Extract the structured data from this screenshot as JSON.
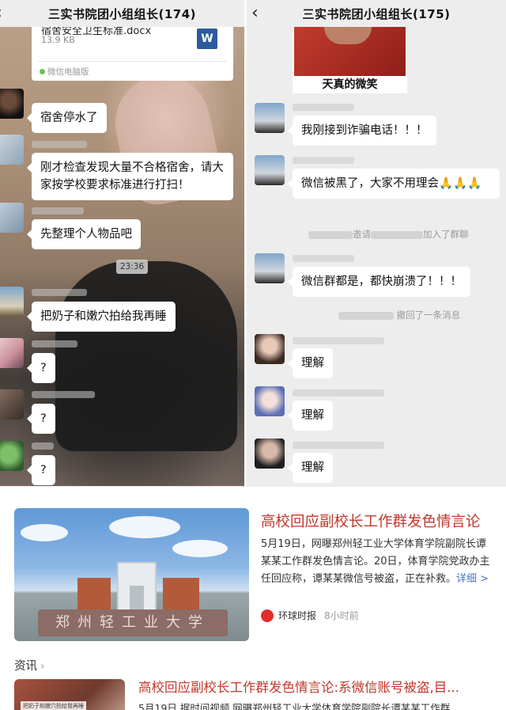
{
  "left_chat": {
    "title": "三实书院团小组组长(174)",
    "file": {
      "name": "宿舍安全卫生标准.docx",
      "size": "13.9 KB",
      "source": "微信电脑版",
      "icon": "W"
    },
    "messages": [
      {
        "text": "宿舍停水了"
      },
      {
        "text": "刚才检查发现大量不合格宿舍，请大家按学校要求标准进行打扫！"
      },
      {
        "text": "先整理个人物品吧"
      },
      {
        "text": "把奶子和嫩穴拍给我再睡"
      },
      {
        "text": "?"
      },
      {
        "text": "?"
      },
      {
        "text": "?"
      }
    ],
    "timestamp": "23:36"
  },
  "right_chat": {
    "title": "三实书院团小组组长(175)",
    "meme_caption": "天真的微笑",
    "messages": [
      {
        "text": "我刚接到诈骗电话！！！"
      },
      {
        "text": "微信被黑了，大家不用理会🙏🙏🙏"
      },
      {
        "text": "微信群都是，都快崩溃了！！！"
      },
      {
        "text": "理解"
      },
      {
        "text": "理解"
      },
      {
        "text": "理解"
      }
    ],
    "system_invite_mid": "邀请",
    "system_invite_end": "加入了群聊",
    "system_recall": "撤回了一条消息"
  },
  "news": {
    "main_title": "高校回应副校长工作群发色情言论",
    "main_body": "5月19日，网曝郑州轻工业大学体育学院副院长谭某某工作群发色情言论。20日，体育学院党政办主任回应称，谭某某微信号被盗，正在补救。",
    "more_label": "详细 >",
    "source_name": "环球时报",
    "source_time": "8小时前",
    "stone_text": "郑州轻工业大学",
    "section_label": "资讯",
    "second_title": "高校回应副校长工作群发色情言论:系微信账号被盗,目...",
    "second_body": "5月19日,据时间视频,网曝郑州轻工业大学体育学院副院长谭某某工作群",
    "thumb_tag": "把奶子和嫩穴拍给我再睡"
  },
  "colors": {
    "chat_bg": "#ededed",
    "headline_red": "#c0392b",
    "link_blue": "#4a77c4"
  }
}
